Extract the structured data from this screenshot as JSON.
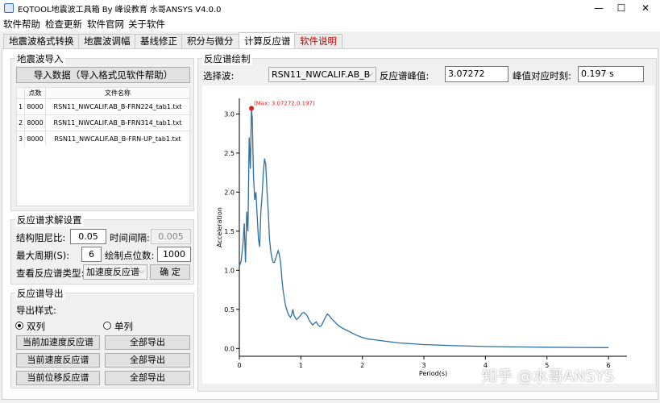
{
  "window": {
    "title": "EQTOOL地震波工具箱 By 峰设教育 水哥ANSYS V4.0.0",
    "minimize": "—",
    "maximize": "☐",
    "close": "✕"
  },
  "menu": [
    "软件帮助",
    "检查更新",
    "软件官网",
    "关于软件"
  ],
  "tabs": [
    "地震波格式转换",
    "地震波调幅",
    "基线修正",
    "积分与微分",
    "计算反应谱",
    "软件说明"
  ],
  "import_group": {
    "title": "地震波导入",
    "button": "导入数据（导入格式见软件帮助）",
    "columns": [
      "",
      "点数",
      "文件名称"
    ],
    "rows": [
      [
        "1",
        "8000",
        "RSN11_NWCALIF.AB_B-FRN224_tab1.txt"
      ],
      [
        "2",
        "8000",
        "RSN11_NWCALIF.AB_B-FRN314_tab1.txt"
      ],
      [
        "3",
        "8000",
        "RSN11_NWCALIF.AB_B-FRN-UP_tab1.txt"
      ]
    ]
  },
  "solve_group": {
    "title": "反应谱求解设置",
    "damping_label": "结构阻尼比:",
    "damping_value": "0.05",
    "dt_label": "时间间隔:",
    "dt_value": "0.005",
    "maxT_label": "最大周期(S):",
    "maxT_value": "6",
    "points_label": "绘制点位数:",
    "points_value": "1000",
    "type_label": "查看反应谱类型:",
    "type_value": "加速度反应谱",
    "confirm": "确  定"
  },
  "export_group": {
    "title": "反应谱导出",
    "style_label": "导出样式:",
    "double_label": "双列",
    "single_label": "单列",
    "btn_acc": "当前加速度反应谱",
    "btn_vel": "当前速度反应谱",
    "btn_disp": "当前位移反应谱",
    "btn_all": "全部导出"
  },
  "plot_group": {
    "title": "反应谱绘制",
    "wave_label": "选择波:",
    "wave_value": "RSN11_NWCALIF.AB_B",
    "peak_label": "反应谱峰值:",
    "peak_value": "3.07272",
    "time_label": "峰值对应时刻:",
    "time_value": "0.197 s"
  },
  "watermark": "知乎 @水哥ANSYS",
  "chart_data": {
    "type": "line",
    "xlabel": "Period(s)",
    "ylabel": "Acceleration",
    "xlim": [
      0,
      6.3
    ],
    "ylim": [
      -0.1,
      3.2
    ],
    "xticks": [
      0,
      1,
      2,
      3,
      4,
      5,
      6
    ],
    "yticks": [
      0.0,
      0.5,
      1.0,
      1.5,
      2.0,
      2.5,
      3.0
    ],
    "line_color": "#2e6fa5",
    "marker_color": "#d42020",
    "annotation": "(Max: 3.07272,0.197)",
    "peak": [
      0.197,
      3.07272
    ],
    "x": [
      0.0,
      0.03,
      0.06,
      0.08,
      0.1,
      0.12,
      0.14,
      0.16,
      0.18,
      0.197,
      0.21,
      0.23,
      0.25,
      0.27,
      0.29,
      0.31,
      0.33,
      0.35,
      0.37,
      0.39,
      0.41,
      0.43,
      0.45,
      0.47,
      0.49,
      0.51,
      0.53,
      0.55,
      0.57,
      0.59,
      0.61,
      0.63,
      0.65,
      0.67,
      0.69,
      0.71,
      0.73,
      0.75,
      0.77,
      0.79,
      0.81,
      0.83,
      0.85,
      0.87,
      0.89,
      0.91,
      0.93,
      0.95,
      0.97,
      0.99,
      1.02,
      1.05,
      1.08,
      1.1,
      1.13,
      1.16,
      1.19,
      1.22,
      1.25,
      1.28,
      1.31,
      1.34,
      1.37,
      1.4,
      1.43,
      1.46,
      1.5,
      1.55,
      1.6,
      1.65,
      1.7,
      1.75,
      1.8,
      1.9,
      2.0,
      2.1,
      2.2,
      2.4,
      2.6,
      2.8,
      3.0,
      3.5,
      4.0,
      4.5,
      5.0,
      5.5,
      6.0
    ],
    "y": [
      1.05,
      1.12,
      1.35,
      1.6,
      1.1,
      1.75,
      1.5,
      2.7,
      2.3,
      3.07272,
      2.95,
      2.2,
      1.9,
      2.0,
      1.7,
      1.4,
      1.3,
      1.75,
      1.95,
      2.25,
      2.43,
      2.35,
      2.0,
      1.75,
      1.4,
      1.25,
      1.15,
      1.1,
      1.1,
      1.15,
      1.2,
      1.25,
      1.2,
      1.1,
      0.9,
      0.75,
      0.65,
      0.55,
      0.5,
      0.45,
      0.42,
      0.4,
      0.43,
      0.5,
      0.42,
      0.39,
      0.37,
      0.38,
      0.4,
      0.42,
      0.45,
      0.46,
      0.44,
      0.42,
      0.37,
      0.33,
      0.3,
      0.32,
      0.34,
      0.3,
      0.28,
      0.3,
      0.35,
      0.4,
      0.44,
      0.42,
      0.38,
      0.34,
      0.3,
      0.27,
      0.25,
      0.23,
      0.21,
      0.17,
      0.14,
      0.12,
      0.11,
      0.09,
      0.07,
      0.06,
      0.05,
      0.035,
      0.025,
      0.02,
      0.015,
      0.012,
      0.01
    ]
  }
}
